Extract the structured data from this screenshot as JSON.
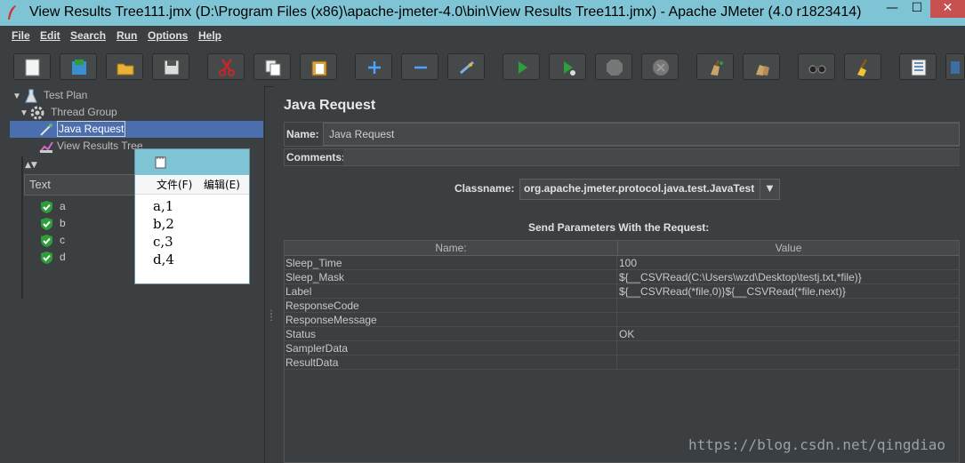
{
  "window": {
    "title": "View Results Tree111.jmx (D:\\Program Files (x86)\\apache-jmeter-4.0\\bin\\View Results Tree111.jmx) - Apache JMeter (4.0 r1823414)",
    "minimize": "—",
    "maximize": "☐",
    "close": "✕"
  },
  "menu": [
    "File",
    "Edit",
    "Search",
    "Run",
    "Options",
    "Help"
  ],
  "toolbar": {
    "buttons": [
      "new-icon",
      "templates-icon",
      "open-icon",
      "save-icon",
      "cut-icon",
      "copy-icon",
      "paste-icon",
      "expand-icon",
      "collapse-icon",
      "toggle-icon",
      "start-icon",
      "start-no-pause-icon",
      "stop-icon",
      "shutdown-icon",
      "clear-icon",
      "clear-all-icon",
      "search-icon",
      "reset-search-icon",
      "function-helper-icon",
      "help-icon"
    ]
  },
  "tree": {
    "test_plan": "Test Plan",
    "thread_group": "Thread Group",
    "java_request": "Java Request",
    "view_results_tree": "View Results Tree"
  },
  "results": {
    "column": "Text",
    "items": [
      "a",
      "b",
      "c",
      "d"
    ]
  },
  "notepad": {
    "menu_file": "文件(F)",
    "menu_edit": "编辑(E)",
    "lines": [
      "a,1",
      "b,2",
      "c,3",
      "d,4"
    ]
  },
  "sampler": {
    "title": "Java Request",
    "name_label": "Name:",
    "name_value": "Java Request",
    "comments_label": "Comments:",
    "classname_label": "Classname:",
    "classname_value": "org.apache.jmeter.protocol.java.test.JavaTest",
    "params_title": "Send Parameters With the Request:",
    "col_name": "Name:",
    "col_value": "Value",
    "params": [
      {
        "name": "Sleep_Time",
        "value": "100"
      },
      {
        "name": "Sleep_Mask",
        "value": "${__CSVRead(C:\\Users\\wzd\\Desktop\\testj.txt,*file)}"
      },
      {
        "name": "Label",
        "value": "${__CSVRead(*file,0)}${__CSVRead(*file,next)}"
      },
      {
        "name": "ResponseCode",
        "value": ""
      },
      {
        "name": "ResponseMessage",
        "value": ""
      },
      {
        "name": "Status",
        "value": "OK"
      },
      {
        "name": "SamplerData",
        "value": ""
      },
      {
        "name": "ResultData",
        "value": ""
      }
    ]
  },
  "watermark": "https://blog.csdn.net/qingdiao",
  "colors": {
    "accent": "#4b6eaf",
    "success": "#2e9e3a",
    "titlebar": "#7fc4d4"
  }
}
